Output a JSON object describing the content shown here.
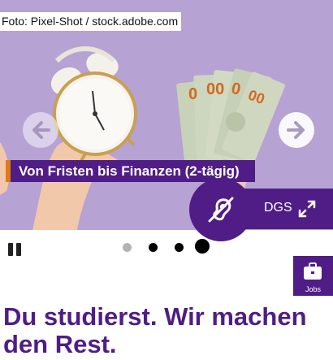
{
  "hero": {
    "photo_credit": "Foto: Pixel-Shot / stock.adobe.com",
    "slide_caption": "Von Fristen bis Finanzen (2-tägig)",
    "sign_language_label": "DGS",
    "slide_count": 4,
    "active_slide": 4
  },
  "jobs_button": {
    "label": "Jobs"
  },
  "headline": "Du studierst. Wir machen den Rest.",
  "colors": {
    "brand_purple": "#4f1d85",
    "hero_background": "#b6a2d3",
    "accent_orange": "#e07b16"
  }
}
